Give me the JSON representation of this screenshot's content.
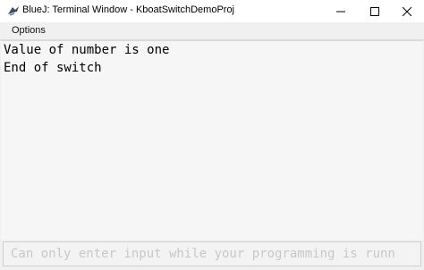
{
  "window": {
    "title": "BlueJ: Terminal Window - KboatSwitchDemoProj",
    "icon": "bluej-bird-icon",
    "controls": {
      "minimize_icon": "minimize-icon",
      "maximize_icon": "maximize-icon",
      "close_icon": "close-icon"
    }
  },
  "menubar": {
    "items": [
      {
        "label": "Options"
      }
    ]
  },
  "terminal": {
    "lines": [
      "Value of number is one",
      "End of switch"
    ]
  },
  "input": {
    "placeholder": "Can only enter input while your programming is runn"
  },
  "colors": {
    "window_bg": "#f0f0f0",
    "titlebar_bg": "#ffffff",
    "output_bg": "#f6f6f6",
    "placeholder_text": "#c8c8c8"
  }
}
